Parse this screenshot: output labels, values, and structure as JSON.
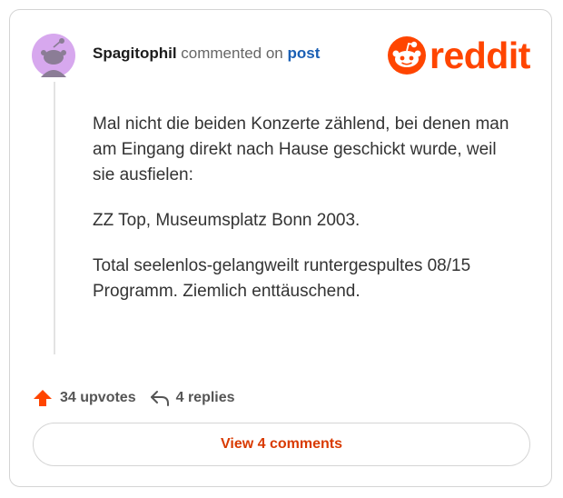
{
  "comment": {
    "username": "Spagitophil",
    "action": "commented on",
    "link": "post",
    "paragraphs": [
      "Mal nicht die beiden Konzerte zählend, bei denen man am Eingang direkt nach Hause geschickt wurde, weil sie ausfielen:",
      "ZZ Top, Museumsplatz Bonn 2003.",
      "Total seelenlos-gelangweilt runtergespultes 08/15 Programm. Ziemlich enttäuschend."
    ]
  },
  "brand": {
    "logo_text": "reddit",
    "color": "#ff4500"
  },
  "stats": {
    "upvotes": "34 upvotes",
    "replies": "4 replies"
  },
  "view_button": {
    "label": "View 4 comments"
  },
  "icons": {
    "upvote": "upvote-arrow-icon",
    "reply": "reply-arrow-icon",
    "snoo": "reddit-snoo-icon"
  }
}
